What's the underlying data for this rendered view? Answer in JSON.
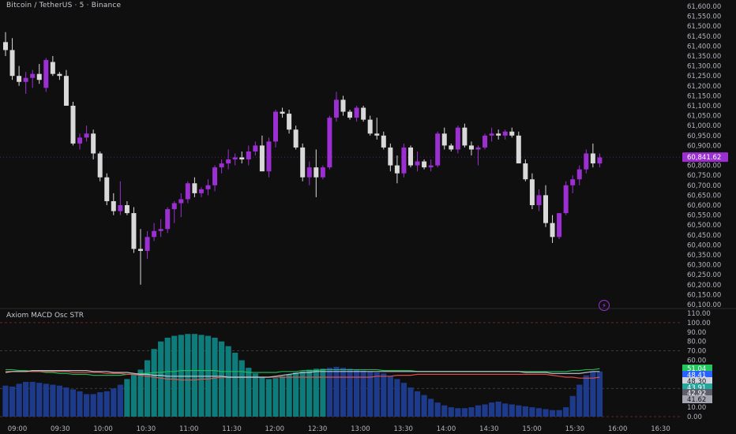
{
  "header": {
    "title": "Bitcoin / TetherUS · 5 · Binance"
  },
  "oscillator": {
    "title": "Axiom MACD Osc STR"
  },
  "price_axis": {
    "ticks": [
      "61,600.00",
      "61,550.00",
      "61,500.00",
      "61,450.00",
      "61,400.00",
      "61,350.00",
      "61,300.00",
      "61,250.00",
      "61,200.00",
      "61,150.00",
      "61,100.00",
      "61,050.00",
      "61,000.00",
      "60,950.00",
      "60,900.00",
      "60,850.00",
      "60,800.00",
      "60,750.00",
      "60,700.00",
      "60,650.00",
      "60,600.00",
      "60,550.00",
      "60,500.00",
      "60,450.00",
      "60,400.00",
      "60,350.00",
      "60,300.00",
      "60,250.00",
      "60,200.00",
      "60,150.00",
      "60,100.00"
    ],
    "last_price_label": "60,841.62"
  },
  "osc_axis": {
    "ticks": [
      "110.00",
      "100.00",
      "90.00",
      "80.00",
      "70.00",
      "60.00",
      "40.00",
      "30.00",
      "20.00",
      "10.00",
      "0.00"
    ],
    "value_badges": [
      {
        "text": "51.04",
        "color": "#22c55e"
      },
      {
        "text": "48.41",
        "color": "#2962ff"
      },
      {
        "text": "48.30",
        "color": "#d1d4dc"
      },
      {
        "text": "43.91",
        "color": "#26a69a"
      },
      {
        "text": "42.92",
        "color": "#5d606b"
      },
      {
        "text": "41.62",
        "color": "#a3a6af"
      }
    ]
  },
  "time_axis": {
    "labels": [
      "09:00",
      "09:30",
      "10:00",
      "10:30",
      "11:00",
      "11:30",
      "12:00",
      "12:30",
      "13:00",
      "13:30",
      "14:00",
      "14:30",
      "15:00",
      "15:30",
      "16:00",
      "16:30"
    ]
  },
  "colors": {
    "bull": "#9b2fd2",
    "bear": "#d9d9d9",
    "hist_blue": "#1e3a8a",
    "hist_teal": "#0e7c7b",
    "grid": "#1a1a1a",
    "accent": "#9b2fd2"
  },
  "chart_data": {
    "type": "candlestick",
    "interval": "5",
    "ylim": [
      60100,
      61600
    ],
    "candles": [
      {
        "o": 61420,
        "h": 61470,
        "l": 61350,
        "c": 61380
      },
      {
        "o": 61380,
        "h": 61440,
        "l": 61230,
        "c": 61250
      },
      {
        "o": 61250,
        "h": 61300,
        "l": 61200,
        "c": 61220
      },
      {
        "o": 61220,
        "h": 61270,
        "l": 61160,
        "c": 61240
      },
      {
        "o": 61240,
        "h": 61280,
        "l": 61190,
        "c": 61260
      },
      {
        "o": 61260,
        "h": 61310,
        "l": 61210,
        "c": 61230
      },
      {
        "o": 61190,
        "h": 61340,
        "l": 61170,
        "c": 61330
      },
      {
        "o": 61320,
        "h": 61350,
        "l": 61250,
        "c": 61260
      },
      {
        "o": 61260,
        "h": 61270,
        "l": 61230,
        "c": 61250
      },
      {
        "o": 61250,
        "h": 61280,
        "l": 61100,
        "c": 61100
      },
      {
        "o": 61100,
        "h": 61120,
        "l": 60900,
        "c": 60910
      },
      {
        "o": 60910,
        "h": 60960,
        "l": 60880,
        "c": 60940
      },
      {
        "o": 60940,
        "h": 61000,
        "l": 60920,
        "c": 60960
      },
      {
        "o": 60960,
        "h": 60980,
        "l": 60830,
        "c": 60860
      },
      {
        "o": 60860,
        "h": 60870,
        "l": 60720,
        "c": 60740
      },
      {
        "o": 60740,
        "h": 60760,
        "l": 60600,
        "c": 60620
      },
      {
        "o": 60620,
        "h": 60660,
        "l": 60550,
        "c": 60570
      },
      {
        "o": 60570,
        "h": 60720,
        "l": 60550,
        "c": 60600
      },
      {
        "o": 60600,
        "h": 60620,
        "l": 60550,
        "c": 60560
      },
      {
        "o": 60560,
        "h": 60590,
        "l": 60360,
        "c": 60380
      },
      {
        "o": 60380,
        "h": 60480,
        "l": 60200,
        "c": 60370
      },
      {
        "o": 60370,
        "h": 60470,
        "l": 60330,
        "c": 60440
      },
      {
        "o": 60440,
        "h": 60510,
        "l": 60420,
        "c": 60470
      },
      {
        "o": 60470,
        "h": 60530,
        "l": 60440,
        "c": 60480
      },
      {
        "o": 60480,
        "h": 60590,
        "l": 60460,
        "c": 60580
      },
      {
        "o": 60580,
        "h": 60620,
        "l": 60510,
        "c": 60610
      },
      {
        "o": 60610,
        "h": 60660,
        "l": 60540,
        "c": 60630
      },
      {
        "o": 60630,
        "h": 60720,
        "l": 60610,
        "c": 60710
      },
      {
        "o": 60710,
        "h": 60740,
        "l": 60640,
        "c": 60660
      },
      {
        "o": 60660,
        "h": 60690,
        "l": 60640,
        "c": 60680
      },
      {
        "o": 60680,
        "h": 60730,
        "l": 60650,
        "c": 60700
      },
      {
        "o": 60700,
        "h": 60800,
        "l": 60670,
        "c": 60790
      },
      {
        "o": 60790,
        "h": 60830,
        "l": 60760,
        "c": 60810
      },
      {
        "o": 60810,
        "h": 60880,
        "l": 60780,
        "c": 60830
      },
      {
        "o": 60830,
        "h": 60860,
        "l": 60800,
        "c": 60840
      },
      {
        "o": 60840,
        "h": 60870,
        "l": 60810,
        "c": 60830
      },
      {
        "o": 60830,
        "h": 60900,
        "l": 60800,
        "c": 60870
      },
      {
        "o": 60870,
        "h": 60920,
        "l": 60850,
        "c": 60900
      },
      {
        "o": 60900,
        "h": 60950,
        "l": 60830,
        "c": 60770
      },
      {
        "o": 60770,
        "h": 60940,
        "l": 60740,
        "c": 60920
      },
      {
        "o": 60920,
        "h": 61080,
        "l": 60890,
        "c": 61070
      },
      {
        "o": 61070,
        "h": 61090,
        "l": 61040,
        "c": 61060
      },
      {
        "o": 61060,
        "h": 61080,
        "l": 60960,
        "c": 60980
      },
      {
        "o": 60980,
        "h": 61000,
        "l": 60880,
        "c": 60890
      },
      {
        "o": 60890,
        "h": 60910,
        "l": 60720,
        "c": 60740
      },
      {
        "o": 60740,
        "h": 60820,
        "l": 60700,
        "c": 60790
      },
      {
        "o": 60790,
        "h": 60880,
        "l": 60640,
        "c": 60740
      },
      {
        "o": 60740,
        "h": 60800,
        "l": 60730,
        "c": 60790
      },
      {
        "o": 60790,
        "h": 61050,
        "l": 60780,
        "c": 61040
      },
      {
        "o": 61040,
        "h": 61170,
        "l": 61020,
        "c": 61130
      },
      {
        "o": 61130,
        "h": 61150,
        "l": 61050,
        "c": 61070
      },
      {
        "o": 61070,
        "h": 61080,
        "l": 61030,
        "c": 61040
      },
      {
        "o": 61040,
        "h": 61100,
        "l": 61020,
        "c": 61090
      },
      {
        "o": 61090,
        "h": 61100,
        "l": 61020,
        "c": 61030
      },
      {
        "o": 61030,
        "h": 61050,
        "l": 60950,
        "c": 60960
      },
      {
        "o": 60960,
        "h": 61040,
        "l": 60930,
        "c": 60950
      },
      {
        "o": 60950,
        "h": 60970,
        "l": 60880,
        "c": 60890
      },
      {
        "o": 60890,
        "h": 60910,
        "l": 60770,
        "c": 60800
      },
      {
        "o": 60800,
        "h": 60850,
        "l": 60710,
        "c": 60760
      },
      {
        "o": 60760,
        "h": 60910,
        "l": 60740,
        "c": 60890
      },
      {
        "o": 60890,
        "h": 60900,
        "l": 60790,
        "c": 60800
      },
      {
        "o": 60800,
        "h": 60870,
        "l": 60770,
        "c": 60820
      },
      {
        "o": 60820,
        "h": 60830,
        "l": 60780,
        "c": 60790
      },
      {
        "o": 60790,
        "h": 60830,
        "l": 60770,
        "c": 60800
      },
      {
        "o": 60800,
        "h": 60970,
        "l": 60790,
        "c": 60960
      },
      {
        "o": 60960,
        "h": 60990,
        "l": 60880,
        "c": 60900
      },
      {
        "o": 60900,
        "h": 60910,
        "l": 60870,
        "c": 60880
      },
      {
        "o": 60880,
        "h": 61000,
        "l": 60860,
        "c": 60990
      },
      {
        "o": 60990,
        "h": 61010,
        "l": 60890,
        "c": 60900
      },
      {
        "o": 60900,
        "h": 60920,
        "l": 60850,
        "c": 60880
      },
      {
        "o": 60880,
        "h": 60900,
        "l": 60800,
        "c": 60890
      },
      {
        "o": 60890,
        "h": 60960,
        "l": 60880,
        "c": 60950
      },
      {
        "o": 60950,
        "h": 60990,
        "l": 60920,
        "c": 60960
      },
      {
        "o": 60960,
        "h": 60980,
        "l": 60930,
        "c": 60950
      },
      {
        "o": 60950,
        "h": 60980,
        "l": 60930,
        "c": 60970
      },
      {
        "o": 60970,
        "h": 60990,
        "l": 60940,
        "c": 60950
      },
      {
        "o": 60950,
        "h": 60970,
        "l": 60900,
        "c": 60810
      },
      {
        "o": 60810,
        "h": 60830,
        "l": 60720,
        "c": 60730
      },
      {
        "o": 60730,
        "h": 60760,
        "l": 60580,
        "c": 60600
      },
      {
        "o": 60600,
        "h": 60680,
        "l": 60570,
        "c": 60650
      },
      {
        "o": 60650,
        "h": 60700,
        "l": 60490,
        "c": 60510
      },
      {
        "o": 60510,
        "h": 60550,
        "l": 60410,
        "c": 60440
      },
      {
        "o": 60440,
        "h": 60560,
        "l": 60430,
        "c": 60560
      },
      {
        "o": 60560,
        "h": 60720,
        "l": 60550,
        "c": 60700
      },
      {
        "o": 60700,
        "h": 60750,
        "l": 60660,
        "c": 60730
      },
      {
        "o": 60730,
        "h": 60800,
        "l": 60700,
        "c": 60780
      },
      {
        "o": 60780,
        "h": 60880,
        "l": 60760,
        "c": 60860
      },
      {
        "o": 60860,
        "h": 60910,
        "l": 60790,
        "c": 60810
      },
      {
        "o": 60810,
        "h": 60860,
        "l": 60790,
        "c": 60840
      }
    ],
    "last_price": 60841.62,
    "oscillator": {
      "name": "Axiom MACD Osc STR",
      "ylim": [
        0,
        110
      ],
      "levels": [
        100,
        70,
        30,
        0
      ],
      "histogram": [
        33,
        32,
        35,
        37,
        37,
        36,
        35,
        34,
        33,
        31,
        29,
        27,
        24,
        24,
        26,
        27,
        30,
        34,
        40,
        45,
        50,
        60,
        72,
        80,
        84,
        86,
        87,
        88,
        88,
        87,
        86,
        84,
        80,
        75,
        68,
        60,
        52,
        46,
        42,
        40,
        41,
        43,
        45,
        47,
        48,
        50,
        51,
        51,
        52,
        53,
        52,
        51,
        50,
        49,
        48,
        47,
        46,
        43,
        40,
        36,
        31,
        27,
        23,
        19,
        15,
        12,
        10,
        9,
        9,
        10,
        12,
        13,
        15,
        16,
        14,
        13,
        12,
        11,
        10,
        9,
        8,
        7,
        7,
        10,
        22,
        34,
        44,
        48,
        48
      ],
      "teal_range": [
        18,
        47
      ],
      "series": [
        {
          "name": "line-1",
          "color": "#22c55e",
          "values": [
            50,
            50,
            49,
            49,
            48,
            48,
            47,
            47,
            46,
            46,
            45,
            45,
            45,
            44,
            44,
            44,
            44,
            44,
            45,
            45,
            46,
            46,
            47,
            47,
            48,
            48,
            49,
            49,
            49,
            49,
            49,
            49,
            48,
            48,
            48,
            48,
            47,
            47,
            47,
            47,
            47,
            48,
            48,
            48,
            49,
            49,
            49,
            50,
            50,
            50,
            50,
            50,
            50,
            50,
            50,
            50,
            49,
            49,
            49,
            49,
            49,
            48,
            48,
            48,
            48,
            48,
            48,
            48,
            48,
            48,
            48,
            48,
            48,
            48,
            48,
            48,
            48,
            48,
            48,
            48,
            48,
            48,
            48,
            48,
            49,
            49,
            50,
            50,
            51
          ]
        },
        {
          "name": "line-2",
          "color": "#ef5350",
          "values": [
            48,
            48,
            48,
            48,
            48,
            48,
            48,
            48,
            48,
            48,
            47,
            47,
            47,
            47,
            47,
            46,
            46,
            46,
            45,
            45,
            44,
            43,
            42,
            41,
            40,
            40,
            39,
            39,
            39,
            40,
            40,
            41,
            42,
            42,
            42,
            42,
            42,
            42,
            42,
            42,
            42,
            42,
            42,
            42,
            42,
            42,
            42,
            42,
            42,
            42,
            42,
            42,
            42,
            42,
            42,
            43,
            43,
            43,
            44,
            44,
            44,
            45,
            45,
            45,
            45,
            45,
            45,
            45,
            45,
            45,
            45,
            45,
            45,
            45,
            45,
            45,
            45,
            45,
            45,
            45,
            45,
            44,
            43,
            42,
            42,
            41,
            41,
            41,
            42
          ]
        },
        {
          "name": "line-3",
          "color": "#d1d4dc",
          "values": [
            47,
            48,
            48,
            48,
            49,
            49,
            49,
            49,
            49,
            49,
            49,
            49,
            49,
            48,
            48,
            48,
            47,
            47,
            47,
            46,
            45,
            45,
            44,
            44,
            43,
            43,
            43,
            43,
            43,
            43,
            43,
            43,
            43,
            42,
            42,
            42,
            42,
            42,
            42,
            42,
            43,
            44,
            45,
            46,
            47,
            47,
            48,
            48,
            48,
            48,
            48,
            48,
            48,
            48,
            48,
            48,
            48,
            48,
            48,
            48,
            48,
            48,
            48,
            48,
            48,
            48,
            48,
            48,
            48,
            48,
            48,
            48,
            48,
            48,
            48,
            48,
            48,
            47,
            47,
            47,
            47,
            46,
            46,
            46,
            46,
            46,
            47,
            48,
            48
          ]
        }
      ]
    }
  }
}
